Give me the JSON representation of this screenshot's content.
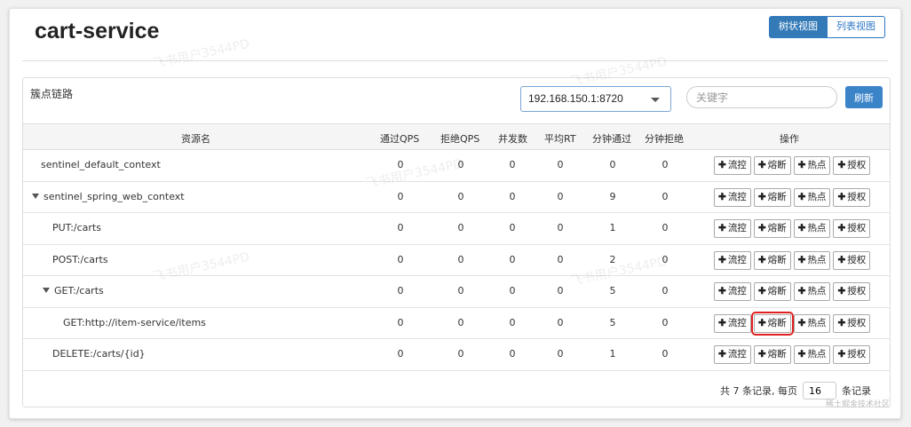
{
  "app_title": "cart-service",
  "view_toggle": {
    "tree_label": "树状视图",
    "list_label": "列表视图"
  },
  "panel": {
    "title": "簇点链路",
    "ip_select": "192.168.150.1:8720",
    "search_placeholder": "关键字",
    "refresh_label": "刷新"
  },
  "table": {
    "headers": [
      "资源名",
      "通过QPS",
      "拒绝QPS",
      "并发数",
      "平均RT",
      "分钟通过",
      "分钟拒绝",
      "操作"
    ],
    "actions": [
      "流控",
      "熔断",
      "热点",
      "授权"
    ],
    "rows": [
      {
        "name": "sentinel_default_context",
        "pass_qps": "0",
        "block_qps": "0",
        "concurrency": "0",
        "avg_rt": "0",
        "min_pass": "0",
        "min_block": "0"
      },
      {
        "name": "sentinel_spring_web_context",
        "pass_qps": "0",
        "block_qps": "0",
        "concurrency": "0",
        "avg_rt": "0",
        "min_pass": "9",
        "min_block": "0"
      },
      {
        "name": "PUT:/carts",
        "pass_qps": "0",
        "block_qps": "0",
        "concurrency": "0",
        "avg_rt": "0",
        "min_pass": "1",
        "min_block": "0"
      },
      {
        "name": "POST:/carts",
        "pass_qps": "0",
        "block_qps": "0",
        "concurrency": "0",
        "avg_rt": "0",
        "min_pass": "2",
        "min_block": "0"
      },
      {
        "name": "GET:/carts",
        "pass_qps": "0",
        "block_qps": "0",
        "concurrency": "0",
        "avg_rt": "0",
        "min_pass": "5",
        "min_block": "0"
      },
      {
        "name": "GET:http://item-service/items",
        "pass_qps": "0",
        "block_qps": "0",
        "concurrency": "0",
        "avg_rt": "0",
        "min_pass": "5",
        "min_block": "0"
      },
      {
        "name": "DELETE:/carts/{id}",
        "pass_qps": "0",
        "block_qps": "0",
        "concurrency": "0",
        "avg_rt": "0",
        "min_pass": "1",
        "min_block": "0"
      }
    ]
  },
  "pager": {
    "prefix": "共 7 条记录, 每页",
    "page_size": "16",
    "suffix": "条记录"
  },
  "watermark_text": "飞书用户3544PD",
  "footer_mark": "稀土掘金技术社区"
}
